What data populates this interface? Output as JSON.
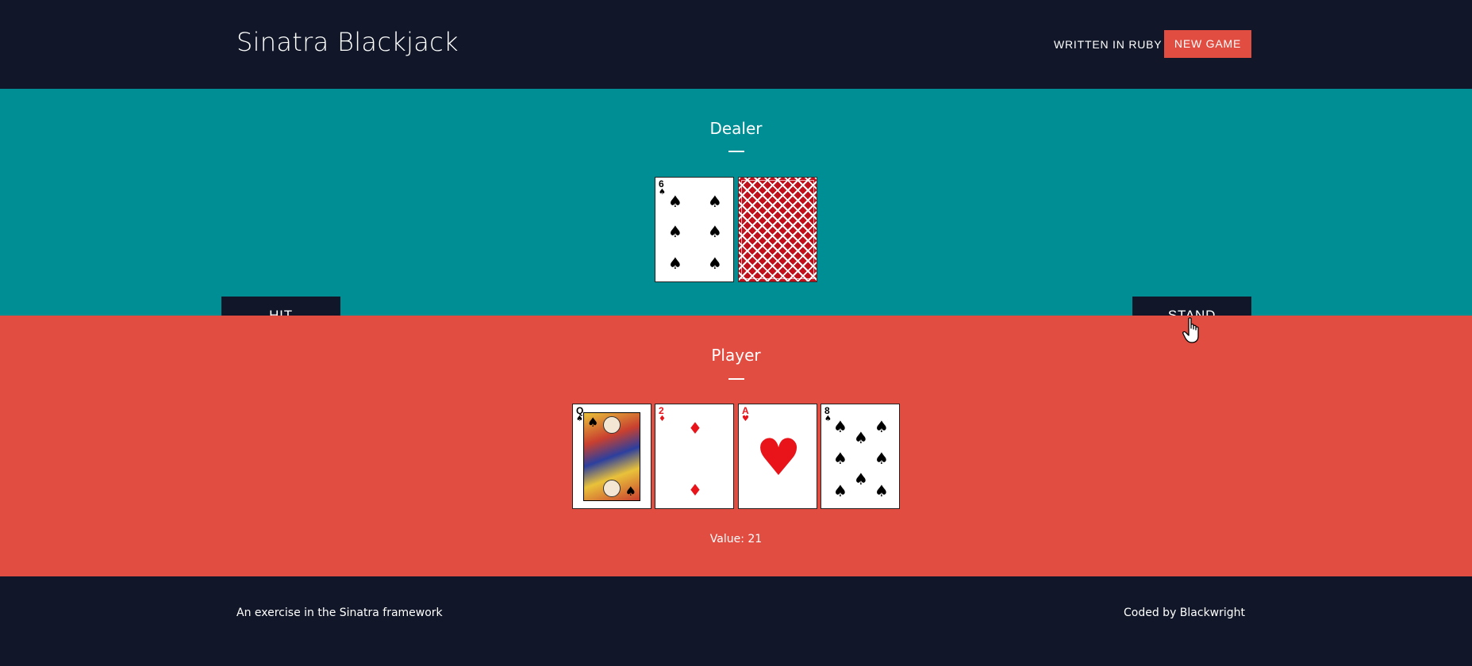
{
  "header": {
    "brand": "Sinatra Blackjack",
    "nav_link": "WRITTEN IN RUBY",
    "new_game": "NEW GAME"
  },
  "dealer": {
    "title": "Dealer",
    "cards": [
      {
        "rank": "6",
        "suit": "♠",
        "color": "black",
        "face_up": true
      },
      {
        "rank": "",
        "suit": "",
        "color": "",
        "face_up": false
      }
    ]
  },
  "actions": {
    "hit": "HIT",
    "stand": "STAND"
  },
  "player": {
    "title": "Player",
    "cards": [
      {
        "rank": "Q",
        "suit": "♠",
        "color": "black",
        "face_up": true
      },
      {
        "rank": "2",
        "suit": "♦",
        "color": "red",
        "face_up": true
      },
      {
        "rank": "A",
        "suit": "♥",
        "color": "red",
        "face_up": true
      },
      {
        "rank": "8",
        "suit": "♠",
        "color": "black",
        "face_up": true
      }
    ],
    "value_text": "Value: 21"
  },
  "footer": {
    "left": "An exercise in the Sinatra framework",
    "right": "Coded by Blackwright"
  },
  "colors": {
    "dark": "#111728",
    "teal": "#008e95",
    "red": "#e24d42"
  },
  "icons": {
    "cursor": "hand-pointer-icon"
  }
}
